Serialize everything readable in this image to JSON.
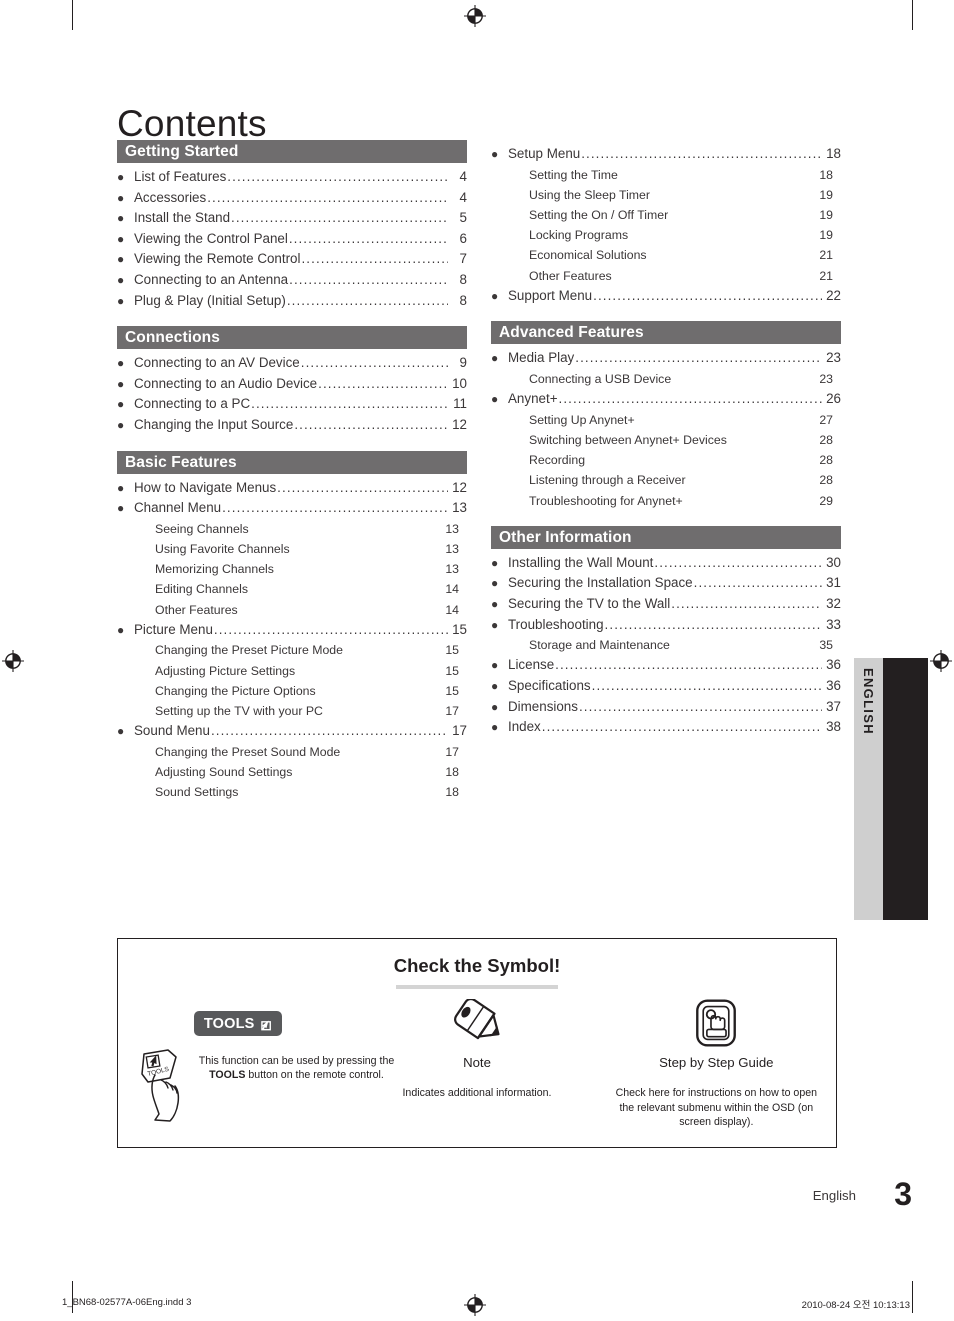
{
  "page_title": "Contents",
  "sections": [
    {
      "id": "getting-started",
      "column": "left",
      "header": "Getting Started",
      "entries": [
        {
          "level": 1,
          "title": "List of Features",
          "page": "4"
        },
        {
          "level": 1,
          "title": "Accessories",
          "page": "4"
        },
        {
          "level": 1,
          "title": "Install the Stand",
          "page": "5"
        },
        {
          "level": 1,
          "title": "Viewing the Control Panel",
          "page": "6"
        },
        {
          "level": 1,
          "title": "Viewing the Remote Control",
          "page": "7"
        },
        {
          "level": 1,
          "title": "Connecting to an Antenna",
          "page": "8"
        },
        {
          "level": 1,
          "title": "Plug & Play (Initial Setup)",
          "page": "8"
        }
      ]
    },
    {
      "id": "connections",
      "column": "left",
      "header": "Connections",
      "entries": [
        {
          "level": 1,
          "title": "Connecting to an AV Device",
          "page": "9"
        },
        {
          "level": 1,
          "title": "Connecting to an Audio Device",
          "page": "10"
        },
        {
          "level": 1,
          "title": "Connecting to a PC",
          "page": "11"
        },
        {
          "level": 1,
          "title": "Changing the Input Source",
          "page": "12"
        }
      ]
    },
    {
      "id": "basic-features",
      "column": "left",
      "header": "Basic Features",
      "entries": [
        {
          "level": 1,
          "title": "How to Navigate Menus",
          "page": "12"
        },
        {
          "level": 1,
          "title": "Channel Menu",
          "page": "13"
        },
        {
          "level": 2,
          "title": "Seeing Channels",
          "page": "13"
        },
        {
          "level": 2,
          "title": "Using Favorite Channels",
          "page": "13"
        },
        {
          "level": 2,
          "title": "Memorizing Channels",
          "page": "13"
        },
        {
          "level": 2,
          "title": "Editing Channels",
          "page": "14"
        },
        {
          "level": 2,
          "title": "Other Features",
          "page": "14"
        },
        {
          "level": 1,
          "title": "Picture Menu",
          "page": "15"
        },
        {
          "level": 2,
          "title": "Changing the Preset Picture Mode",
          "page": "15"
        },
        {
          "level": 2,
          "title": "Adjusting Picture Settings",
          "page": "15"
        },
        {
          "level": 2,
          "title": "Changing the Picture Options",
          "page": "15"
        },
        {
          "level": 2,
          "title": "Setting up the TV with your PC",
          "page": "17"
        },
        {
          "level": 1,
          "title": "Sound Menu",
          "page": "17"
        },
        {
          "level": 2,
          "title": "Changing the Preset Sound Mode",
          "page": "17"
        },
        {
          "level": 2,
          "title": "Adjusting Sound Settings",
          "page": "18"
        },
        {
          "level": 2,
          "title": "Sound Settings",
          "page": "18"
        }
      ]
    },
    {
      "id": "setup-support",
      "column": "right",
      "header": null,
      "entries": [
        {
          "level": 1,
          "title": "Setup Menu",
          "page": "18"
        },
        {
          "level": 2,
          "title": "Setting the Time",
          "page": "18"
        },
        {
          "level": 2,
          "title": "Using the Sleep Timer",
          "page": "19"
        },
        {
          "level": 2,
          "title": "Setting the On / Off Timer",
          "page": "19"
        },
        {
          "level": 2,
          "title": "Locking Programs",
          "page": "19"
        },
        {
          "level": 2,
          "title": "Economical Solutions",
          "page": "21"
        },
        {
          "level": 2,
          "title": "Other Features",
          "page": "21"
        },
        {
          "level": 1,
          "title": "Support Menu",
          "page": "22"
        }
      ]
    },
    {
      "id": "advanced-features",
      "column": "right",
      "header": "Advanced Features",
      "entries": [
        {
          "level": 1,
          "title": "Media Play",
          "page": "23"
        },
        {
          "level": 2,
          "title": "Connecting a USB Device",
          "page": "23"
        },
        {
          "level": 1,
          "title": "Anynet+",
          "page": "26"
        },
        {
          "level": 2,
          "title": "Setting Up Anynet+",
          "page": "27"
        },
        {
          "level": 2,
          "title": "Switching between Anynet+ Devices",
          "page": "28"
        },
        {
          "level": 2,
          "title": "Recording",
          "page": "28"
        },
        {
          "level": 2,
          "title": "Listening through a Receiver",
          "page": "28"
        },
        {
          "level": 2,
          "title": "Troubleshooting for Anynet+",
          "page": "29"
        }
      ]
    },
    {
      "id": "other-information",
      "column": "right",
      "header": "Other Information",
      "entries": [
        {
          "level": 1,
          "title": "Installing the Wall Mount",
          "page": "30"
        },
        {
          "level": 1,
          "title": "Securing the Installation Space",
          "page": "31"
        },
        {
          "level": 1,
          "title": "Securing the TV to the Wall",
          "page": "32"
        },
        {
          "level": 1,
          "title": "Troubleshooting",
          "page": "33"
        },
        {
          "level": 2,
          "title": "Storage and Maintenance",
          "page": "35"
        },
        {
          "level": 1,
          "title": "License",
          "page": "36"
        },
        {
          "level": 1,
          "title": "Specifications",
          "page": "36"
        },
        {
          "level": 1,
          "title": "Dimensions",
          "page": "37"
        },
        {
          "level": 1,
          "title": "Index",
          "page": "38"
        }
      ]
    }
  ],
  "side_tab": {
    "label": "ENGLISH"
  },
  "symbol_box": {
    "title": "Check the Symbol!",
    "tools": {
      "badge_text": "TOOLS",
      "caption_lead": "This function can be used by pressing the",
      "caption_bold": "TOOLS",
      "caption_tail": "button on the remote control."
    },
    "note": {
      "label": "Note",
      "description": "Indicates additional information."
    },
    "step_guide": {
      "label": "Step by Step Guide",
      "description": "Check here for instructions on how to open the relevant submenu within the OSD (on screen display)."
    }
  },
  "footer": {
    "language": "English",
    "page_number": "3",
    "print_file": "1_BN68-02577A-06Eng.indd   3",
    "print_timestamp": "2010-08-24   오전 10:13:13"
  },
  "colors": {
    "section_header_bg": "#6f6d6e",
    "text": "#231f20",
    "tab_gray": "#cfcfcf",
    "tab_black": "#231f20",
    "tools_badge_bg": "#58595b"
  }
}
